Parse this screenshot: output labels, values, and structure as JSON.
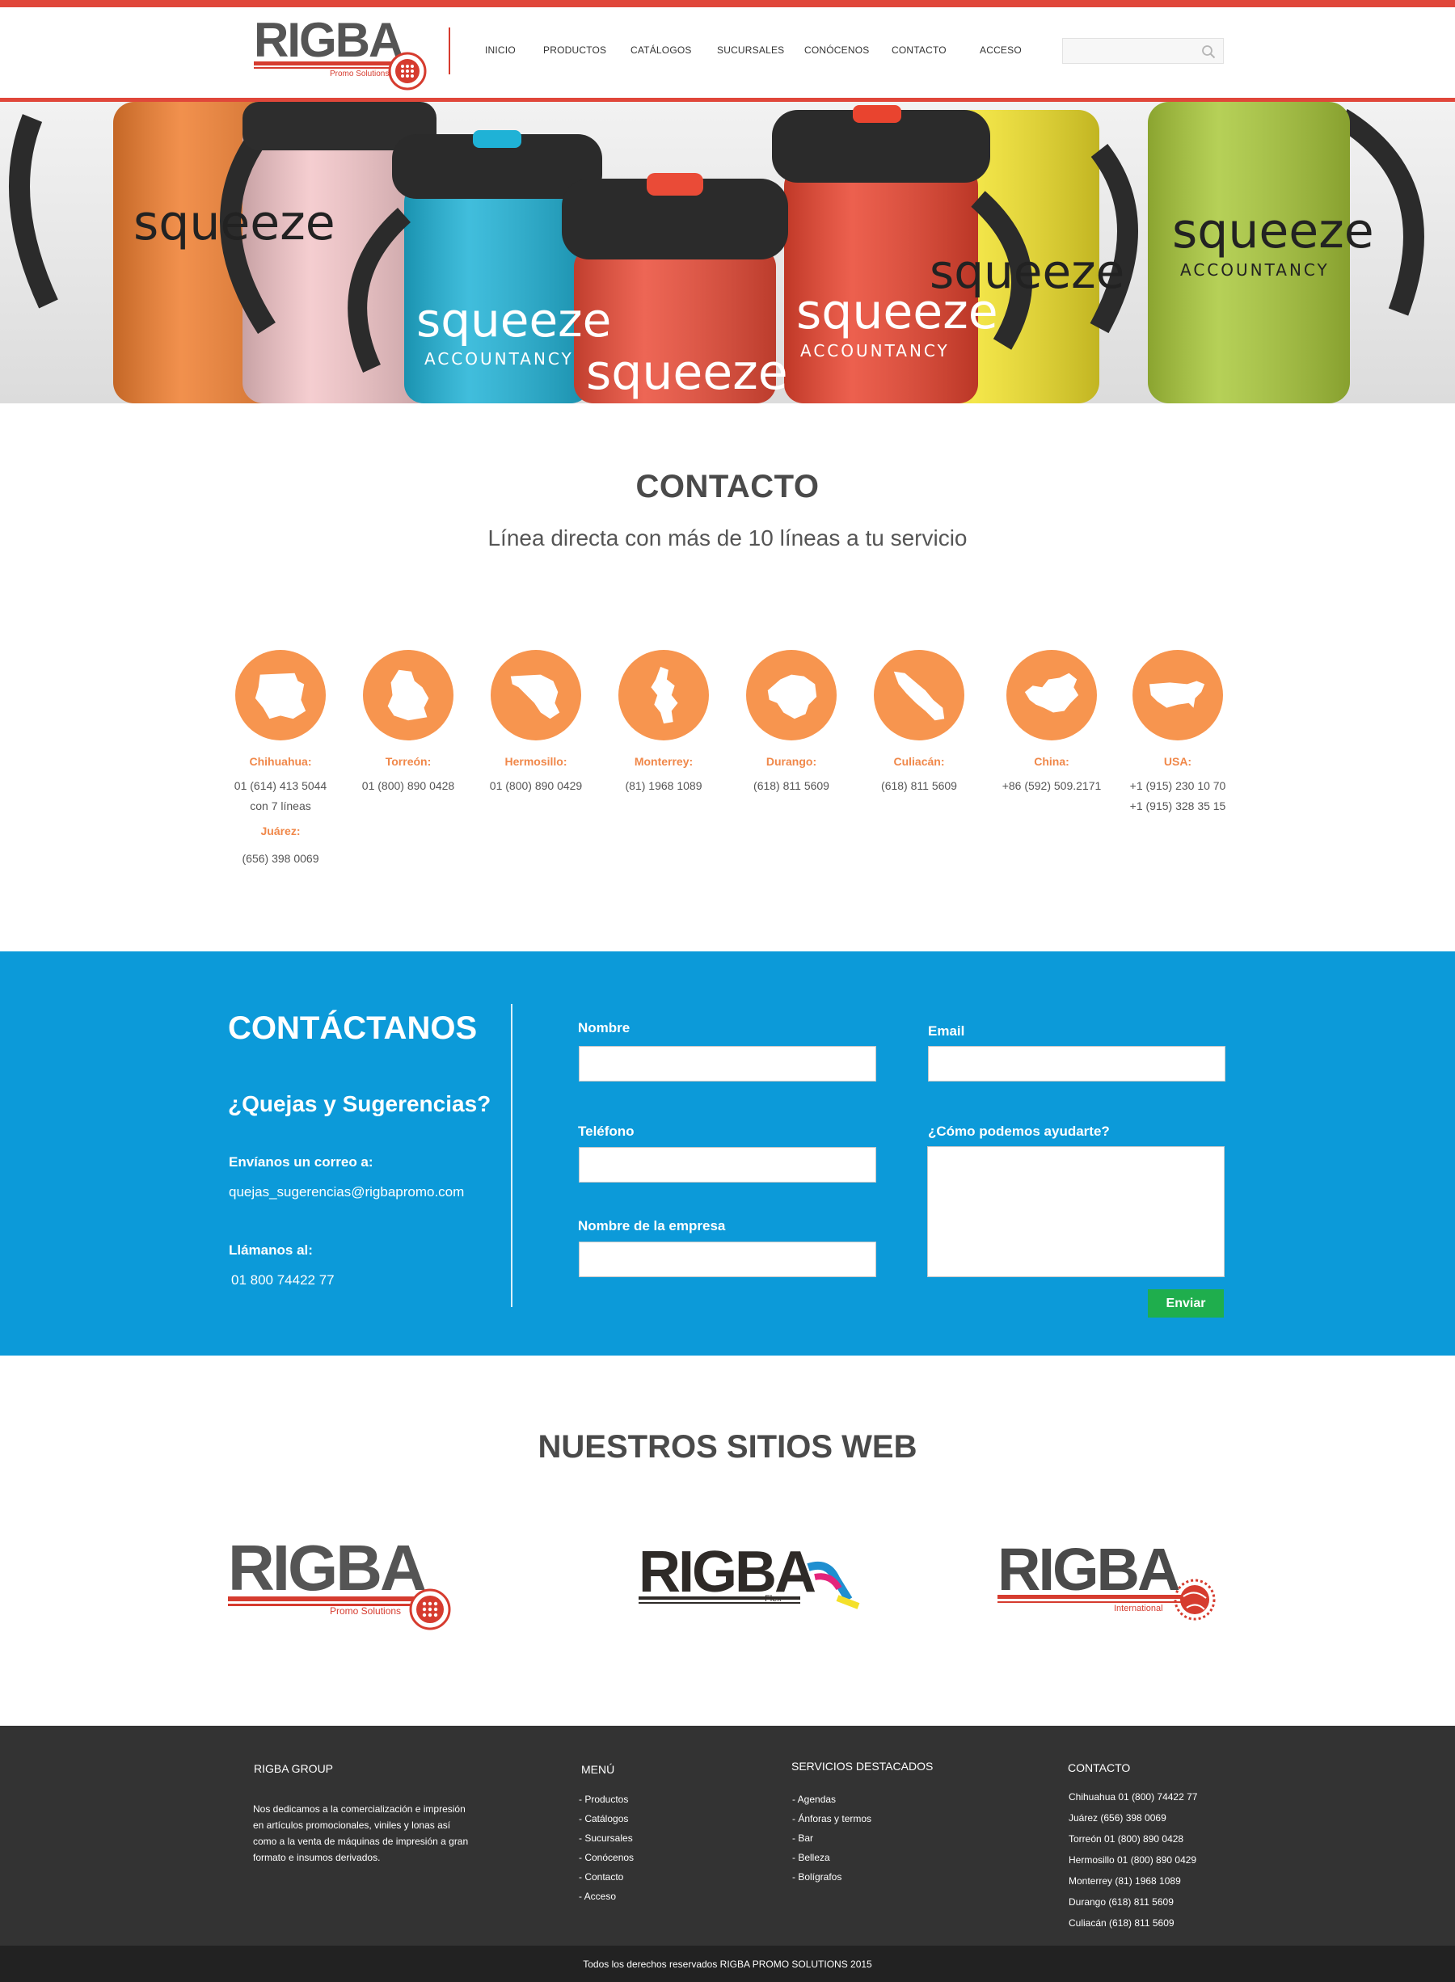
{
  "header": {
    "logo_text": "RIGBA",
    "logo_tagline": "Promo Solutions",
    "nav": [
      {
        "label": "INICIO",
        "name": "nav-inicio"
      },
      {
        "label": "PRODUCTOS",
        "name": "nav-productos"
      },
      {
        "label": "CATÁLOGOS",
        "name": "nav-catalogos"
      },
      {
        "label": "SUCURSALES",
        "name": "nav-sucursales"
      },
      {
        "label": "CONÓCENOS",
        "name": "nav-conocenos"
      },
      {
        "label": "CONTACTO",
        "name": "nav-contacto"
      },
      {
        "label": "ACCESO",
        "name": "nav-acceso"
      }
    ],
    "search": {
      "value": "",
      "placeholder": ""
    }
  },
  "hero": {
    "mug_text": "squeeze",
    "mug_subtext": "ACCOUNTANCY"
  },
  "contact": {
    "title": "CONTACTO",
    "subtitle": "Línea directa con más de 10 líneas a tu servicio",
    "branches": [
      {
        "city": "Chihuahua:",
        "phones": [
          "01 (614) 413 5044",
          "con 7 líneas"
        ],
        "city2": "Juárez:",
        "phones2": [
          "(656) 398 0069"
        ],
        "icon": "chihuahua-map-icon"
      },
      {
        "city": "Torreón:",
        "phones": [
          "01 (800) 890 0428"
        ],
        "icon": "coahuila-map-icon"
      },
      {
        "city": "Hermosillo:",
        "phones": [
          "01 (800) 890 0429"
        ],
        "icon": "sonora-map-icon"
      },
      {
        "city": "Monterrey:",
        "phones": [
          "(81) 1968 1089"
        ],
        "icon": "nuevo-leon-map-icon"
      },
      {
        "city": "Durango:",
        "phones": [
          "(618) 811 5609"
        ],
        "icon": "durango-map-icon"
      },
      {
        "city": "Culiacán:",
        "phones": [
          "(618) 811 5609"
        ],
        "icon": "sinaloa-map-icon"
      },
      {
        "city": "China:",
        "phones": [
          "+86 (592) 509.2171"
        ],
        "icon": "china-map-icon"
      },
      {
        "city": "USA:",
        "phones": [
          "+1 (915) 230 10 70",
          "+1 (915) 328 35 15"
        ],
        "icon": "usa-map-icon"
      }
    ]
  },
  "contactanos": {
    "title": "CONTÁCTANOS",
    "subtitle": "¿Quejas y Sugerencias?",
    "email_label": "Envíanos un correo a:",
    "email": "quejas_sugerencias@rigbapromo.com",
    "phone_label": "Llámanos al:",
    "phone": "01 800 74422 77",
    "form": {
      "nombre_label": "Nombre",
      "email_label": "Email",
      "telefono_label": "Teléfono",
      "ayuda_label": "¿Cómo podemos ayudarte?",
      "empresa_label": "Nombre de la empresa",
      "nombre_value": "",
      "email_value": "",
      "telefono_value": "",
      "ayuda_value": "",
      "empresa_value": "",
      "submit_label": "Enviar"
    }
  },
  "sites": {
    "title": "NUESTROS SITIOS WEB",
    "logos": [
      {
        "brand": "RIGBA",
        "tagline": "Promo Solutions"
      },
      {
        "brand": "RIGBA",
        "tagline": "Flex"
      },
      {
        "brand": "RIGBA",
        "tagline": "International"
      }
    ]
  },
  "footer": {
    "about_title": "RIGBA GROUP",
    "about_text": "Nos dedicamos a la comercialización e impresión en artículos promocionales, viniles y lonas así como a la venta de máquinas de impresión a gran formato e insumos derivados.",
    "menu_title": "MENÚ",
    "menu": [
      "- Productos",
      "- Catálogos",
      "- Sucursales",
      "- Conócenos",
      "- Contacto",
      "- Acceso"
    ],
    "services_title": "SERVICIOS DESTACADOS",
    "services": [
      "- Agendas",
      "- Ánforas y termos",
      "- Bar",
      "- Belleza",
      "- Bolígrafos"
    ],
    "contact_title": "CONTACTO",
    "contacts": [
      "Chihuahua 01 (800) 74422 77",
      "Juárez (656) 398 0069",
      "Torreón 01 (800) 890 0428",
      "Hermosillo 01 (800) 890 0429",
      "Monterrey (81) 1968 1089",
      "Durango (618) 811 5609",
      "Culiacán (618) 811 5609"
    ],
    "copyright": "Todos los derechos reservados RIGBA PROMO SOLUTIONS 2015"
  },
  "colors": {
    "accent_red": "#e0473a",
    "orange": "#f7954f",
    "blue": "#0c9ad9",
    "green_button": "#1fae4d",
    "footer_dark": "#333333"
  }
}
